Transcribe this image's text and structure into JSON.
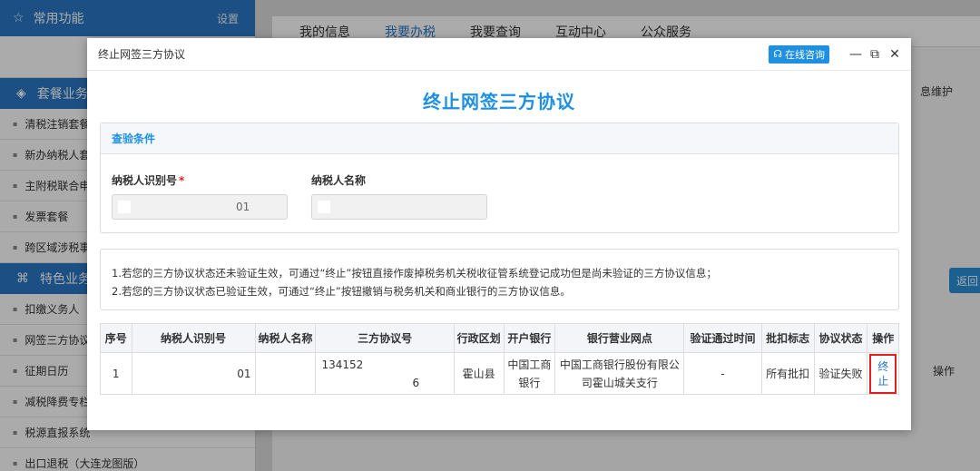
{
  "sidebar": {
    "header_title": "常用功能",
    "header_extra": "设置",
    "section1_title": "套餐业务",
    "items1": [
      "清税注销套餐",
      "新办纳税人套餐",
      "主附税联合申报",
      "发票套餐",
      "跨区域涉税事项"
    ],
    "section2_title": "特色业务",
    "items2": [
      "扣缴义务人",
      "网签三方协议",
      "征期日历",
      "减税降费专栏",
      "税源直报系统",
      "出口退税（大连龙图版）"
    ]
  },
  "top_nav": {
    "tabs": [
      "我的信息",
      "我要办税",
      "我要查询",
      "互动中心",
      "公众服务"
    ]
  },
  "background": {
    "right_text": "息维护",
    "return_button": "返回",
    "op_label": "操作"
  },
  "modal": {
    "window_title": "终止网签三方协议",
    "online_consult": "在线咨询",
    "main_title": "终止网签三方协议",
    "query": {
      "header": "查验条件",
      "taxpayer_id_label": "纳税人识别号",
      "required_mark": "*",
      "taxpayer_id_value": "01",
      "taxpayer_name_label": "纳税人名称",
      "taxpayer_name_value": ""
    },
    "notice": {
      "line1": "1.若您的三方协议状态还未验证生效，可通过“终止”按钮直接作废掉税务机关税收征管系统登记成功但是尚未验证的三方协议信息；",
      "line2": "2.若您的三方协议状态已验证生效，可通过“终止”按钮撤销与税务机关和商业银行的三方协议信息。"
    },
    "table": {
      "columns": [
        "序号",
        "纳税人识别号",
        "纳税人名称",
        "三方协议号",
        "行政区划",
        "开户银行",
        "银行营业网点",
        "验证通过时间",
        "批扣标志",
        "协议状态",
        "操作"
      ],
      "row": {
        "index": "1",
        "taxpayer_id": "01",
        "taxpayer_name": "",
        "agreement_no_prefix": "134152",
        "agreement_no_suffix": "6",
        "region": "霍山县",
        "bank": "中国工商银行",
        "branch": "中国工商银行股份有限公司霍山城关支行",
        "verify_time": "-",
        "batch_flag": "所有批扣",
        "status": "验证失败",
        "action": "终止"
      }
    }
  }
}
